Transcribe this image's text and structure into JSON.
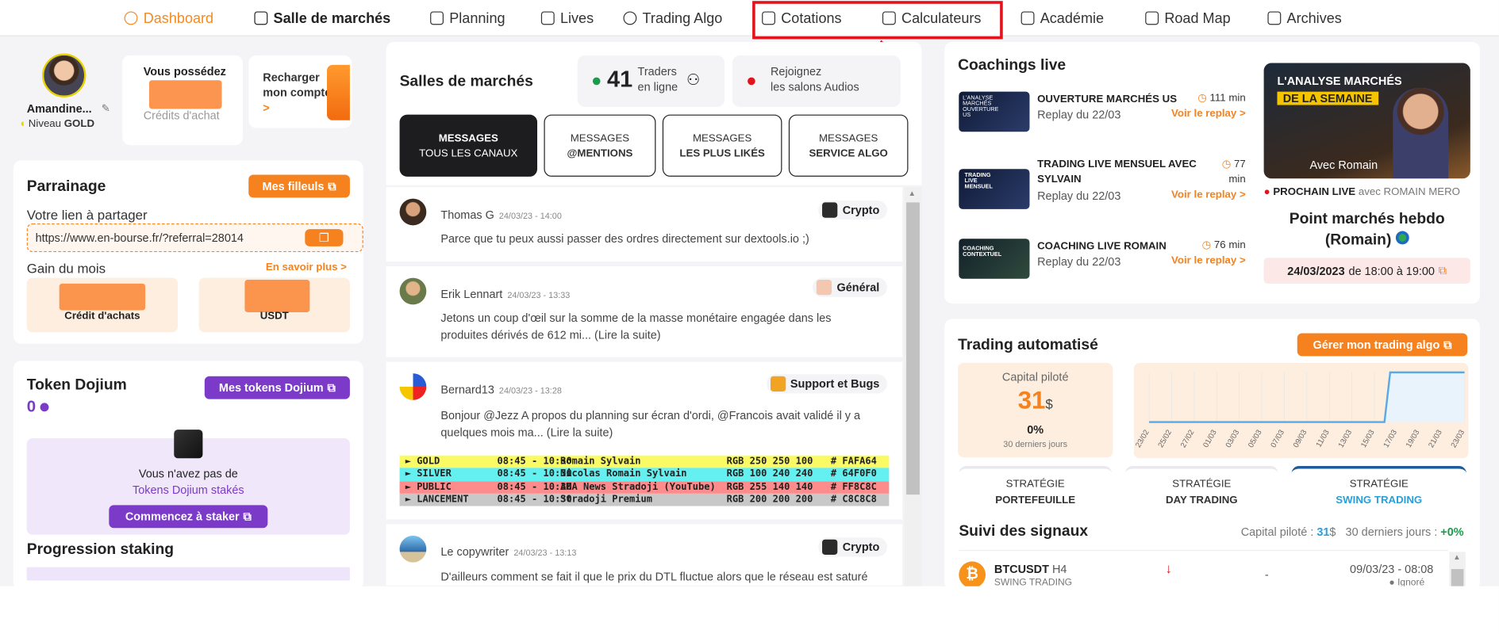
{
  "nav": {
    "items": [
      {
        "label": "Dashboard"
      },
      {
        "label": "Salle de marchés"
      },
      {
        "label": "Planning"
      },
      {
        "label": "Lives"
      },
      {
        "label": "Trading Algo"
      },
      {
        "label": "Cotations"
      },
      {
        "label": "Calculateurs"
      },
      {
        "label": "Académie"
      },
      {
        "label": "Road Map"
      },
      {
        "label": "Archives"
      }
    ]
  },
  "profile": {
    "name": "Amandine...",
    "level_prefix": "Niveau",
    "level": "GOLD",
    "possess_label": "Vous possédez",
    "credits_label": "Crédits d'achat",
    "recharge_line1": "Recharger",
    "recharge_line2": "mon compte",
    "recharge_arrow": ">"
  },
  "parrainage": {
    "title": "Parrainage",
    "button": "Mes filleuls",
    "share_label": "Votre lien à partager",
    "link": "https://www.en-bourse.fr/?referral=28014",
    "gain_label": "Gain du mois",
    "more": "En savoir plus >",
    "credit_label": "Crédit d'achats",
    "usdt_label": "USDT"
  },
  "token": {
    "title": "Token Dojium",
    "button": "Mes tokens Dojium",
    "amount": "0",
    "empty_line1": "Vous n'avez pas de",
    "empty_line2": "Tokens Dojium stakés",
    "stake_button": "Commencez à staker",
    "progress_title": "Progression staking"
  },
  "market": {
    "title": "Salles de marchés",
    "online_count": "41",
    "online_line1": "Traders",
    "online_line2": "en ligne",
    "audio_line1": "Rejoignez",
    "audio_line2": "les salons Audios",
    "tabs": [
      {
        "top": "MESSAGES",
        "bottom": "TOUS LES CANAUX"
      },
      {
        "top": "MESSAGES",
        "bottom": "@MENTIONS"
      },
      {
        "top": "MESSAGES",
        "bottom": "LES PLUS LIKÉS"
      },
      {
        "top": "MESSAGES",
        "bottom": "SERVICE ALGO"
      }
    ],
    "messages": [
      {
        "author": "Thomas G",
        "date": "24/03/23 - 14:00",
        "tag": "Crypto",
        "text": "Parce que tu peux aussi passer des ordres directement sur dextools.io ;)"
      },
      {
        "author": "Erik Lennart",
        "date": "24/03/23 - 13:33",
        "tag": "Général",
        "text": "Jetons un coup d'œil sur la somme de la masse monétaire engagée dans les produites dérivés de 612 mi... (Lire la suite)"
      },
      {
        "author": "Bernard13",
        "date": "24/03/23 - 13:28",
        "tag": "Support et Bugs",
        "text": "Bonjour @Jezz A propos du planning sur écran d'ordi, @Francois avait validé il y a quelques mois ma... (Lire la suite)"
      },
      {
        "author": "Le copywriter",
        "date": "24/03/23 - 13:13",
        "tag": "Crypto",
        "text": "D'ailleurs comment se fait il que le prix du DTL fluctue alors que le réseau est saturé"
      }
    ],
    "schedule": [
      {
        "name": "► GOLD",
        "time": "08:45 - 10:30",
        "who": "Romain Sylvain",
        "rgb": "RGB 250 250 100",
        "hex": "# FAFA64",
        "color": "#fafa64"
      },
      {
        "name": "► SILVER",
        "time": "08:45 - 10:30",
        "who": "Nicolas Romain Sylvain",
        "rgb": "RGB 100 240 240",
        "hex": "# 64F0F0",
        "color": "#64f0f0"
      },
      {
        "name": "► PUBLIC",
        "time": "08:45 - 10:30",
        "who": "AMA News Stradoji (YouTube)",
        "rgb": "RGB 255 140 140",
        "hex": "# FF8C8C",
        "color": "#ff8c8c"
      },
      {
        "name": "► LANCEMENT",
        "time": "08:45 - 10:30",
        "who": "Stradoji Premium",
        "rgb": "RGB 200 200 200",
        "hex": "# C8C8C8",
        "color": "#c8c8c8"
      }
    ]
  },
  "coaching": {
    "title": "Coachings live",
    "items": [
      {
        "title": "OUVERTURE MARCHÉS US",
        "replay": "Replay du 22/03",
        "duration": "111 min",
        "link": "Voir le replay >",
        "thumb_label": "L'ANALYSE MARCHÉS OUVERTURE US"
      },
      {
        "title": "TRADING LIVE MENSUEL AVEC SYLVAIN",
        "replay": "Replay du 22/03",
        "duration": "77 min",
        "link": "Voir le replay >",
        "thumb_label": "TRADING LIVE MENSUEL"
      },
      {
        "title": "COACHING LIVE ROMAIN",
        "replay": "Replay du 22/03",
        "duration": "76 min",
        "link": "Voir le replay >",
        "thumb_label": "COACHING CONTEXTUEL"
      }
    ],
    "feature_banner_line1": "L'ANALYSE MARCHÉS",
    "feature_banner_line2": "DE LA SEMAINE",
    "feature_banner_with": "Avec Romain",
    "next_label": "PROCHAIN LIVE",
    "next_with": "avec ROMAIN MERO",
    "next_title": "Point marchés hebdo (Romain)",
    "next_date": "24/03/2023",
    "next_time": "de 18:00 à 19:00"
  },
  "algo": {
    "title": "Trading automatisé",
    "button": "Gérer mon trading algo",
    "capital_label": "Capital piloté",
    "capital_value": "31",
    "capital_unit": "$",
    "percent": "0%",
    "period": "30 derniers jours",
    "strategies": [
      {
        "top": "STRATÉGIE",
        "bottom": "PORTEFEUILLE"
      },
      {
        "top": "STRATÉGIE",
        "bottom": "DAY TRADING"
      },
      {
        "top": "STRATÉGIE",
        "bottom": "SWING TRADING"
      }
    ]
  },
  "chart_data": {
    "type": "line",
    "x": [
      "23/02",
      "25/02",
      "27/02",
      "01/03",
      "03/03",
      "05/03",
      "07/03",
      "09/03",
      "11/03",
      "13/03",
      "15/03",
      "17/03",
      "19/03",
      "21/03",
      "23/03"
    ],
    "y": [
      0,
      0,
      0,
      0,
      0,
      0,
      0,
      0,
      0,
      0,
      0,
      31,
      31,
      31,
      31
    ],
    "color": "#5aa9e6",
    "fill": "#e8f3fc"
  },
  "signals": {
    "title": "Suivi des signaux",
    "capital_prefix": "Capital piloté :",
    "capital_value": "31",
    "capital_unit": "$",
    "period_prefix": "30 derniers jours :",
    "period_value": "+0%",
    "row_pair": "BTCUSDT",
    "row_tf": "H4",
    "row_strategy": "SWING TRADING",
    "row_dash": "-",
    "row_date": "09/03/23 - 08:08",
    "row_status": "Ignoré"
  },
  "colors": {
    "accent": "#f5821f",
    "purple": "#7b3bc8",
    "highlight": "#e1141d"
  }
}
